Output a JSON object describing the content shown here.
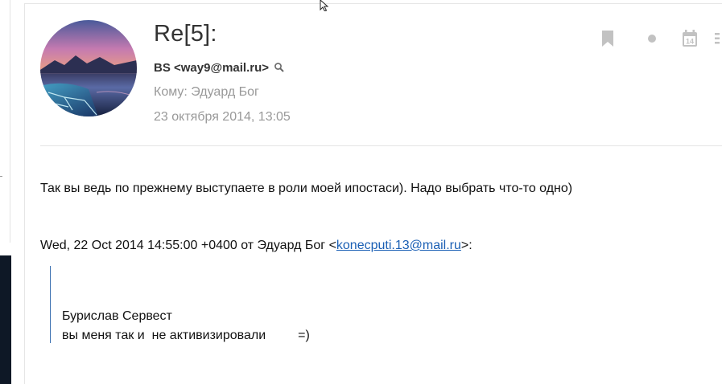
{
  "message": {
    "subject": "Re[5]:",
    "sender": "BS <way9@mail.ru>",
    "recipient_label": "Кому:",
    "recipient_name": "Эдуард Бог",
    "date": "23 октября 2014, 13:05",
    "calendar_day": "14",
    "body": "Так вы ведь по прежнему выступаете в роли моей ипостаси). Надо выбрать что-то одно)"
  },
  "quote": {
    "header_prefix": "Wed, 22 Oct 2014 14:55:00 +0400 от Эдуард Бог <",
    "header_email": "konecputi.13@mail.ru",
    "header_suffix": ">:",
    "lines": [
      "Бурислав Сервест",
      "вы меня так и  не активизировали         =)"
    ]
  },
  "icons": {
    "bookmark": "bookmark-icon",
    "dot": "unread-dot-icon",
    "calendar": "calendar-icon",
    "more": "more-vertical-icon",
    "search": "search-icon"
  },
  "colors": {
    "link": "#1a5fb4",
    "muted": "#999999",
    "quote_bar": "#3a6fb0",
    "icon": "#c2c2c2"
  }
}
